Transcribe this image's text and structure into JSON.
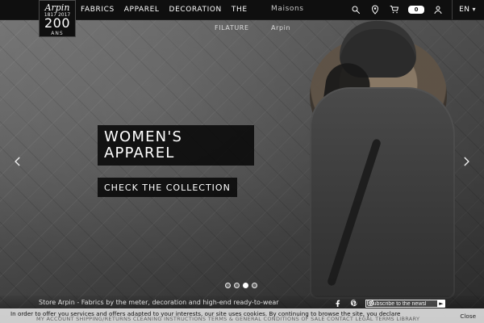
{
  "brand": {
    "logo_script": "Arpin",
    "logo_years": "1817  2017",
    "logo_number": "200",
    "logo_suffix": "ANS"
  },
  "nav": {
    "items": [
      "FABRICS",
      "APPAREL",
      "DECORATION",
      "THE"
    ],
    "subnav_left": "FILATURE",
    "maisons_label": "Maisons",
    "arpin_label": "Arpin",
    "cart_count": "0",
    "lang": "EN"
  },
  "slide": {
    "headline_line1": "WOMEN'S",
    "headline_line2": "APPAREL",
    "cta_label": "CHECK THE COLLECTION",
    "dots_total": 4,
    "active_dot": 3
  },
  "footer": {
    "store_text": "Store Arpin - Fabrics by the meter, decoration and high-end ready-to-wear",
    "newsletter_placeholder": "Subscribe to the newsl"
  },
  "cookie": {
    "message": "In order to offer you services and offers adapted to your interests, our site uses cookies. By continuing to browse the site, you declare",
    "close_label": "Close",
    "links_text": "MY ACCOUNT  SHIPPING/RETURNS  CLEANING INSTRUCTIONS  TERMS & GENERAL CONDITIONS OF SALE  CONTACT  LEGAL TERMS  LIBRARY"
  },
  "icons": {
    "search": "search-icon",
    "location": "location-pin-icon",
    "cart": "cart-icon",
    "user": "user-icon",
    "left": "chevron-left-icon",
    "right": "chevron-right-icon",
    "facebook": "facebook-icon",
    "pinterest": "pinterest-icon",
    "instagram": "instagram-icon"
  }
}
